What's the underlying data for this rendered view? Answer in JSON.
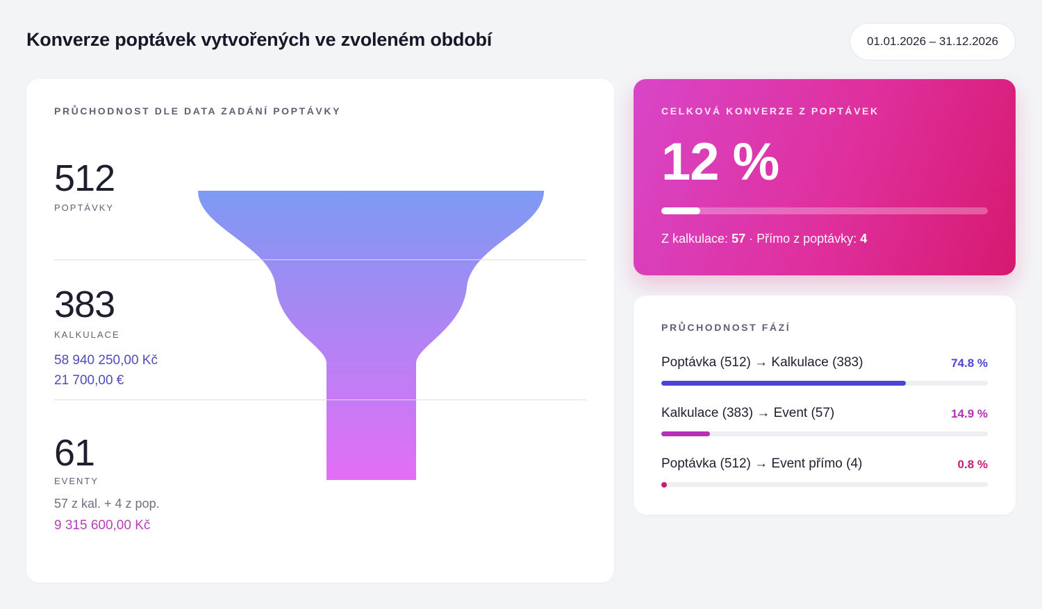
{
  "header": {
    "title": "Konverze poptávek vytvořených ve zvoleném období",
    "date_range": "01.01.2026 – 31.12.2026"
  },
  "funnel_card": {
    "label": "PRŮCHODNOST DLE DATA ZADÁNÍ POPTÁVKY",
    "stages": [
      {
        "value": "512",
        "caption": "POPTÁVKY"
      },
      {
        "value": "383",
        "caption": "KALKULACE",
        "money_czk": "58 940 250,00 Kč",
        "money_eur": "21 700,00 €"
      },
      {
        "value": "61",
        "caption": "EVENTY",
        "note": "57 z kal. + 4 z pop.",
        "money_czk": "9 315 600,00 Kč"
      }
    ],
    "colors": {
      "funnel_top": "#7d9af2",
      "funnel_bottom": "#e36ef5"
    }
  },
  "total_card": {
    "label": "CELKOVÁ KONVERZE Z POPTÁVEK",
    "percent": "12 %",
    "progress_fraction": 0.12,
    "from_calc_label": "Z kalkulace:",
    "from_calc_value": "57",
    "separator": "·",
    "direct_label": "Přímo z poptávky:",
    "direct_value": "4"
  },
  "phases_card": {
    "label": "PRŮCHODNOST FÁZÍ",
    "phases": [
      {
        "label": "Poptávka (512) → Kalkulace (383)",
        "percent": "74.8 %",
        "fraction": 0.748,
        "color": "#4b44d6"
      },
      {
        "label": "Kalkulace (383) → Event (57)",
        "percent": "14.9 %",
        "fraction": 0.149,
        "color": "#b52fb8"
      },
      {
        "label": "Poptávka (512) → Event přímo (4)",
        "percent": "0.8 %",
        "fraction": 0.008,
        "color": "#c71e73"
      }
    ]
  }
}
